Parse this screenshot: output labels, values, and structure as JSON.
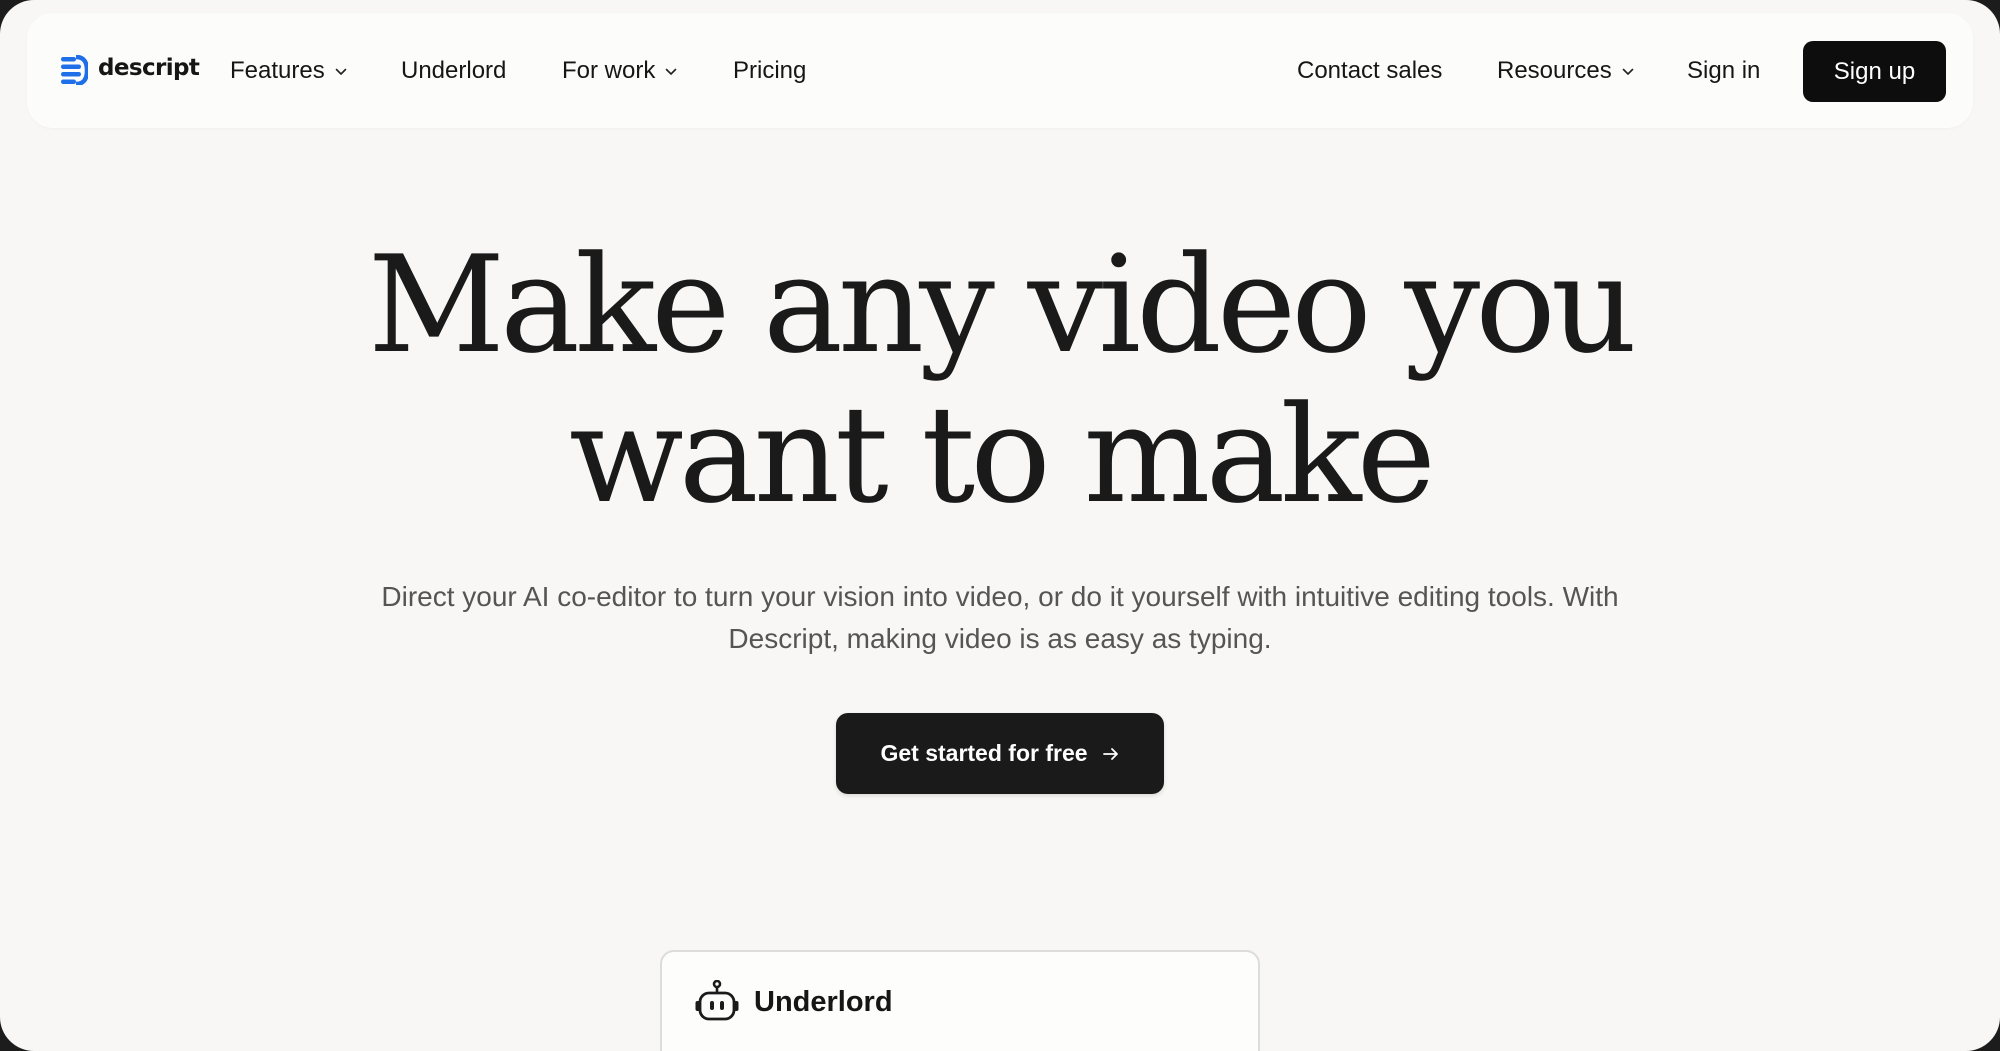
{
  "brand": {
    "name": "descript",
    "logo_icon": "descript-logo-icon",
    "accent": "#1f6fe8"
  },
  "nav": {
    "left": [
      {
        "label": "Features",
        "dropdown": true
      },
      {
        "label": "Underlord",
        "dropdown": false
      },
      {
        "label": "For work",
        "dropdown": true
      },
      {
        "label": "Pricing",
        "dropdown": false
      }
    ],
    "right": [
      {
        "label": "Contact sales",
        "dropdown": false
      },
      {
        "label": "Resources",
        "dropdown": true
      },
      {
        "label": "Sign in",
        "dropdown": false
      }
    ],
    "signup_label": "Sign up",
    "chevron_icon": "chevron-down-icon"
  },
  "hero": {
    "title_line1": "Make any video you",
    "title_line2": "want to make",
    "subtitle": "Direct your AI co-editor to turn your vision into video, or do it yourself with intuitive editing tools. With Descript, making video is as easy as typing.",
    "cta_label": "Get started for free",
    "cta_icon": "arrow-right-icon"
  },
  "card": {
    "title": "Underlord",
    "icon": "robot-icon"
  },
  "colors": {
    "page_bg": "#f8f7f5",
    "nav_bg": "#fcfcfb",
    "text": "#1a1a1a",
    "muted_text": "#555555",
    "button_bg": "#0d0d0d",
    "button_text": "#ffffff"
  }
}
